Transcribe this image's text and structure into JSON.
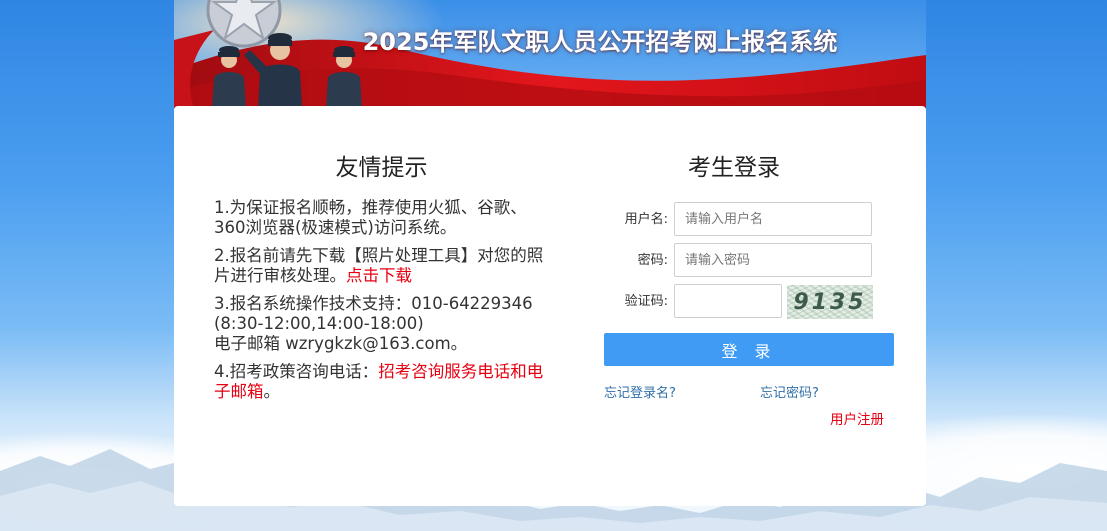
{
  "header": {
    "title": "2025年军队文职人员公开招考网上报名系统"
  },
  "tips": {
    "title": "友情提示",
    "item1": "1.为保证报名顺畅，推荐使用火狐、谷歌、360浏览器(极速模式)访问系统。",
    "item2_text": "2.报名前请先下载【照片处理工具】对您的照片进行审核处理。",
    "item2_link": "点击下载",
    "item3_line1": "3.报名系统操作技术支持：010-64229346 (8:30-12:00,14:00-18:00)",
    "item3_line2": "电子邮箱  wzrygkzk@163.com。",
    "item4_text": "4.招考政策咨询电话：",
    "item4_link": "招考咨询服务电话和电子邮箱",
    "item4_end": "。"
  },
  "login": {
    "title": "考生登录",
    "username_label": "用户名:",
    "username_placeholder": "请输入用户名",
    "password_label": "密码:",
    "password_placeholder": "请输入密码",
    "captcha_label": "验证码:",
    "captcha_value": "",
    "captcha_image_text": "9135",
    "login_button": "登 录",
    "forgot_username": "忘记登录名?",
    "forgot_password": "忘记密码?",
    "register": "用户注册"
  },
  "colors": {
    "accent_blue": "#3f9bf3",
    "link_red": "#e60012",
    "link_blue": "#2f6fa8",
    "banner_red": "#d7141a"
  },
  "icons": {
    "banner_emblem": "army-emblem",
    "banner_figures": "saluting-soldiers"
  }
}
